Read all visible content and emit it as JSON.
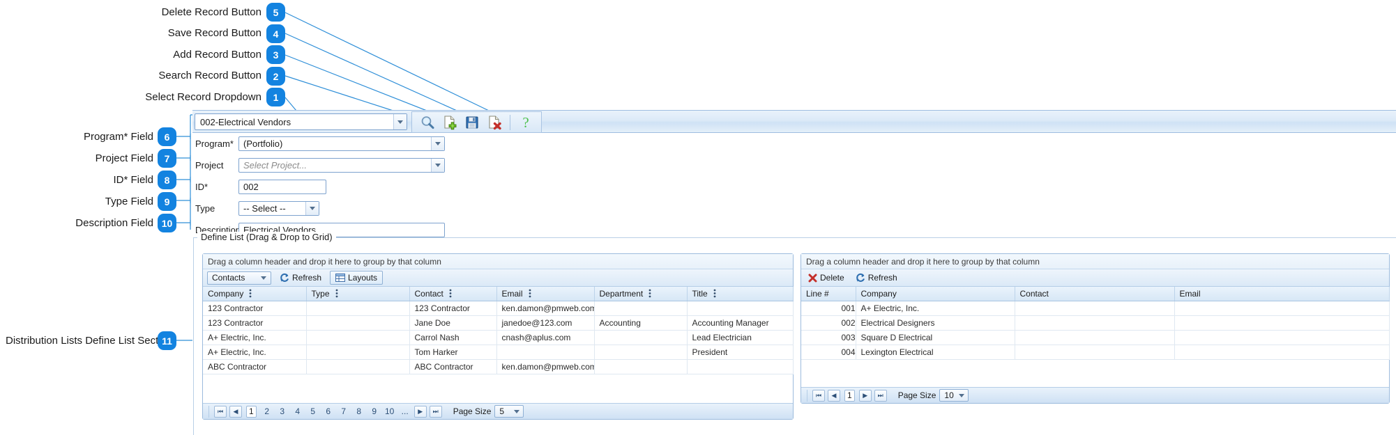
{
  "callouts": [
    {
      "n": "5",
      "label": "Delete Record Button"
    },
    {
      "n": "4",
      "label": "Save Record Button"
    },
    {
      "n": "3",
      "label": "Add Record Button"
    },
    {
      "n": "2",
      "label": "Search Record Button"
    },
    {
      "n": "1",
      "label": "Select Record Dropdown"
    },
    {
      "n": "6",
      "label": "Program* Field"
    },
    {
      "n": "7",
      "label": "Project Field"
    },
    {
      "n": "8",
      "label": "ID* Field"
    },
    {
      "n": "9",
      "label": "Type Field"
    },
    {
      "n": "10",
      "label": "Description Field"
    },
    {
      "n": "11",
      "label": "Distribution Lists Define List Section"
    }
  ],
  "toolbar": {
    "record_value": "002-Electrical Vendors",
    "buttons": [
      {
        "name": "search-record-button",
        "icon": "magnifier-icon",
        "title": "Search"
      },
      {
        "name": "add-record-button",
        "icon": "page-add-icon",
        "title": "Add"
      },
      {
        "name": "save-record-button",
        "icon": "floppy-disk-icon",
        "title": "Save"
      },
      {
        "name": "delete-record-button",
        "icon": "page-delete-icon",
        "title": "Delete"
      },
      {
        "name": "help-button",
        "icon": "question-mark-icon",
        "title": "Help"
      }
    ]
  },
  "form": {
    "program": {
      "label": "Program*",
      "value": "(Portfolio)"
    },
    "project": {
      "label": "Project",
      "value": "",
      "placeholder": "Select Project..."
    },
    "id": {
      "label": "ID*",
      "value": "002"
    },
    "type": {
      "label": "Type",
      "value": "-- Select --"
    },
    "description": {
      "label": "Description",
      "value": "Electrical Vendors"
    }
  },
  "fieldset": {
    "legend": "Define List (Drag & Drop to Grid)"
  },
  "left_grid": {
    "group_hint": "Drag a column header and drop it here to group by that column",
    "source_dropdown": "Contacts",
    "refresh_label": "Refresh",
    "layouts_label": "Layouts",
    "columns": [
      "Company",
      "Type",
      "Contact",
      "Email",
      "Department",
      "Title"
    ],
    "rows": [
      [
        "123 Contractor",
        "",
        "123 Contractor",
        "ken.damon@pmweb.com",
        "",
        ""
      ],
      [
        "123 Contractor",
        "",
        "Jane Doe",
        "janedoe@123.com",
        "Accounting",
        "Accounting Manager"
      ],
      [
        "A+ Electric, Inc.",
        "",
        "Carrol Nash",
        "cnash@aplus.com",
        "",
        "Lead Electrician"
      ],
      [
        "A+ Electric, Inc.",
        "",
        "Tom Harker",
        "",
        "",
        "President"
      ],
      [
        "ABC Contractor",
        "",
        "ABC Contractor",
        "ken.damon@pmweb.com",
        "",
        ""
      ]
    ],
    "pager": {
      "pages": [
        "1",
        "2",
        "3",
        "4",
        "5",
        "6",
        "7",
        "8",
        "9",
        "10",
        "..."
      ],
      "current": "1",
      "page_size_label": "Page Size",
      "page_size": "5"
    }
  },
  "right_grid": {
    "group_hint": "Drag a column header and drop it here to group by that column",
    "delete_label": "Delete",
    "refresh_label": "Refresh",
    "columns": [
      "Line #",
      "Company",
      "Contact",
      "Email"
    ],
    "rows": [
      [
        "001",
        "A+ Electric, Inc.",
        "",
        ""
      ],
      [
        "002",
        "Electrical Designers",
        "",
        ""
      ],
      [
        "003",
        "Square D Electrical",
        "",
        ""
      ],
      [
        "004",
        "Lexington Electrical",
        "",
        ""
      ]
    ],
    "pager": {
      "current": "1",
      "page_size_label": "Page Size",
      "page_size": "10"
    }
  },
  "colors": {
    "badge": "#1383e0",
    "leader": "#2f8fd8",
    "panel_border": "#9cbbdd"
  }
}
